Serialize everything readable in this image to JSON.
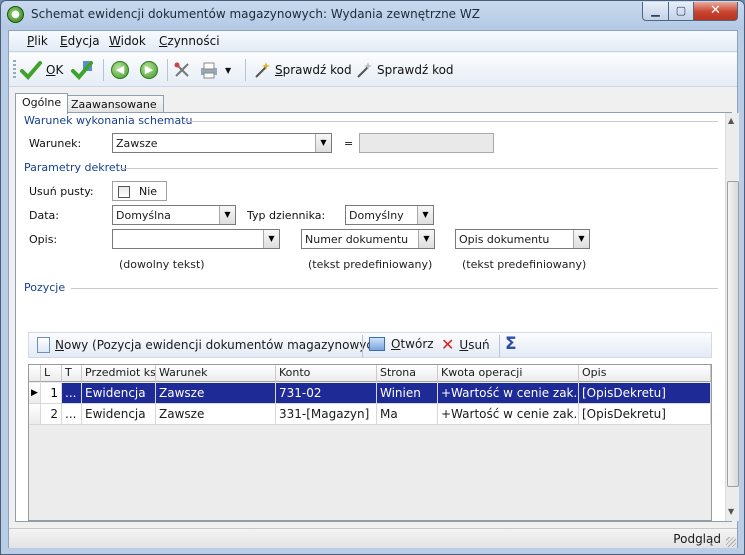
{
  "window": {
    "title": "Schemat ewidencji dokumentów magazynowych: Wydania zewnętrzne WZ",
    "minimize": "▁",
    "maximize": "▢",
    "close": "✕"
  },
  "menu": [
    "Plik",
    "Edycja",
    "Widok",
    "Czynności"
  ],
  "toolbar": {
    "ok_label": "OK",
    "check_code_1": "Sprawdź kod",
    "check_code_2": "Sprawdź kod",
    "back_glyph": "◀",
    "forward_glyph": "▶",
    "dropdown_glyph": "▼"
  },
  "tabs": [
    {
      "label": "Ogólne",
      "active": true
    },
    {
      "label": "Zaawansowane",
      "active": false
    }
  ],
  "section_condition": {
    "title": "Warunek wykonania schematu",
    "condition_label": "Warunek:",
    "condition_value": "Zawsze",
    "equals": "="
  },
  "section_decree": {
    "title": "Parametry dekretu",
    "remove_empty_label": "Usuń pusty:",
    "remove_empty_value": "Nie",
    "date_label": "Data:",
    "date_value": "Domyślna",
    "journal_type_label": "Typ dziennika:",
    "journal_type_value": "Domyślny",
    "desc_label": "Opis:",
    "desc_value": "",
    "desc_combo_2": "Numer dokumentu",
    "desc_combo_3": "Opis dokumentu",
    "hint_1": "(dowolny tekst)",
    "hint_2": "(tekst predefiniowany)",
    "hint_3": "(tekst predefiniowany)"
  },
  "section_items": {
    "title": "Pozycje",
    "new_button": "Nowy (Pozycja ewidencji dokumentów magazynowych)",
    "open_button": "Otwórz",
    "delete_button": "Usuń",
    "sigma": "Σ"
  },
  "grid": {
    "columns": [
      "L",
      "T",
      "Przedmiot ks",
      "Warunek",
      "Konto",
      "Strona",
      "Kwota operacji",
      "Opis"
    ],
    "rows": [
      {
        "indicator": "▶",
        "l": "1",
        "t": "...",
        "subject": "Ewidencja",
        "condition": "Zawsze",
        "account": "731-02",
        "side": "Winien",
        "amount": "+Wartość w cenie zak...",
        "desc": "[OpisDekretu]",
        "selected": true
      },
      {
        "indicator": "",
        "l": "2",
        "t": "...",
        "subject": "Ewidencja",
        "condition": "Zawsze",
        "account": "331-[Magazyn]",
        "side": "Ma",
        "amount": "+Wartość w cenie zak...",
        "desc": "[OpisDekretu]",
        "selected": false
      }
    ]
  },
  "status": {
    "text": "Podgląd"
  },
  "colors": {
    "selection": "#1e2a96",
    "section_title": "#17408c",
    "close_button": "#c7442e"
  }
}
